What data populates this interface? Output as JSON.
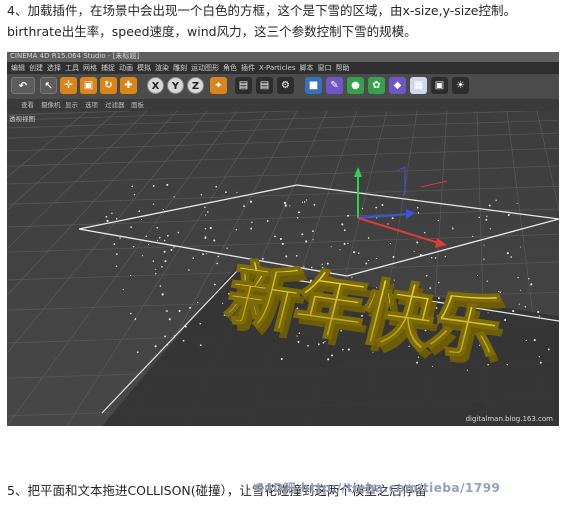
{
  "step4": {
    "line1": "4、加载插件，在场景中会出现一个白色的方框，这个是下雪的区域，由x-size,y-size控制。",
    "line2": "birthrate出生率，speed速度，wind风力，这三个参数控制下雪的规模。"
  },
  "app": {
    "title": "CINEMA 4D R15.064 Studio - [未标题]"
  },
  "menu": {
    "items": [
      "编辑",
      "创建",
      "选择",
      "工具",
      "网格",
      "捕捉",
      "动画",
      "模拟",
      "渲染",
      "雕刻",
      "运动图形",
      "角色",
      "插件",
      "X-Particles",
      "脚本",
      "窗口",
      "帮助"
    ]
  },
  "toolbar": {
    "x_label": "X",
    "y_label": "Y",
    "z_label": "Z"
  },
  "view_menu": {
    "items": [
      "查看",
      "摄像机",
      "显示",
      "选项",
      "过滤器",
      "面板"
    ]
  },
  "viewport": {
    "name": "透视视图",
    "text_3d": "新年快乐",
    "text_color": "#e0c21a",
    "grid_color": "#5a5a5a",
    "floor_color": "#2f2f2f",
    "axis_colors": {
      "x": "#e03a3a",
      "y": "#2fd24a",
      "z": "#3a56e0"
    }
  },
  "watermark": "digitalman.blog.163.com",
  "step5": {
    "text": "5、把平面和文本拖进COLLISON(碰撞），让雪花碰撞到这两个模型之后停留"
  },
  "overlay": {
    "text": "C4D吧 http://tieba.com/tieba/1799"
  }
}
